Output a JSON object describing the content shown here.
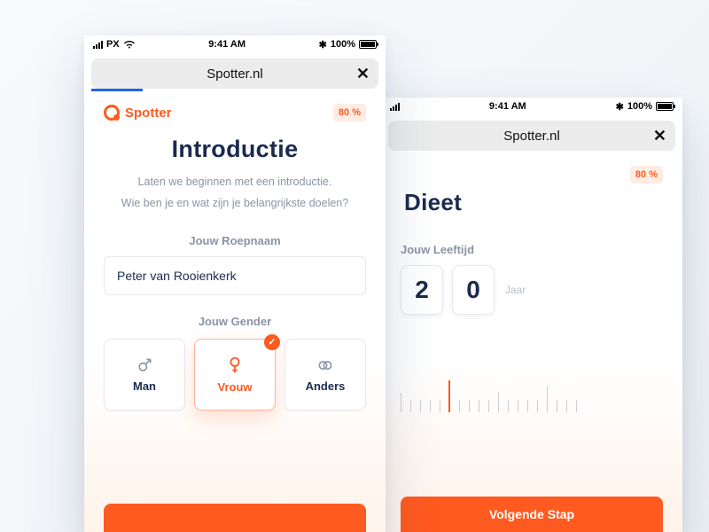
{
  "status": {
    "carrier": "PX",
    "time": "9:41 AM",
    "battery_pct": "100%"
  },
  "url": "Spotter.nl",
  "brand": "Spotter",
  "progress_pct": "80 %",
  "front": {
    "title": "Introductie",
    "sub1": "Laten we beginnen met een introductie.",
    "sub2": "Wie ben je en wat zijn je belangrijkste doelen?",
    "name_label": "Jouw Roepnaam",
    "name_value": "Peter van Rooienkerk",
    "gender_label": "Jouw Gender",
    "genders": {
      "man": "Man",
      "vrouw": "Vrouw",
      "anders": "Anders"
    }
  },
  "back": {
    "title": "Dieet",
    "age_label": "Jouw Leeftijd",
    "digits": [
      "2",
      "0"
    ],
    "jaar": "Jaar",
    "next": "Volgende Stap"
  }
}
